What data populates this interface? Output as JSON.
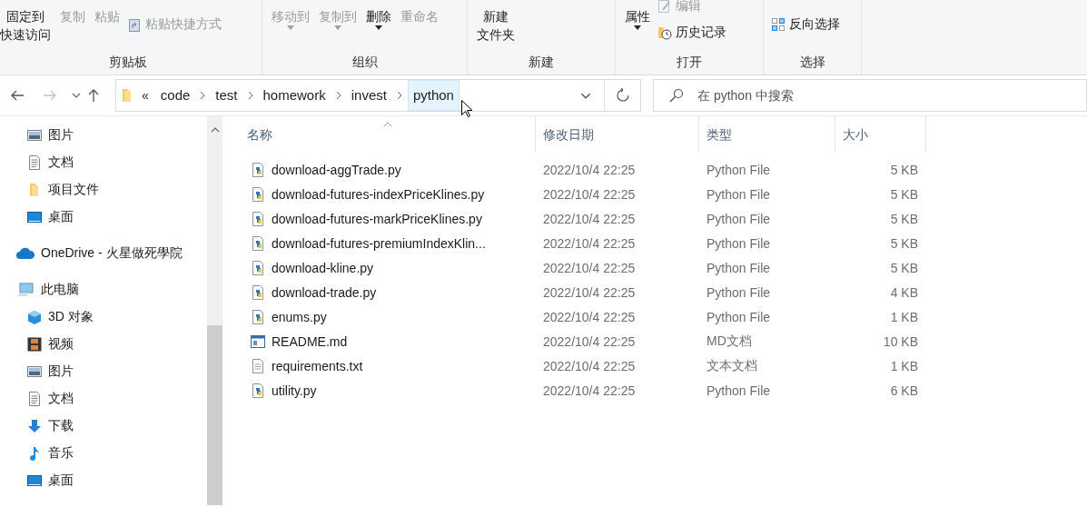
{
  "ribbon": {
    "groups": [
      {
        "label": "剪贴板",
        "large": [
          {
            "lines": [
              "固定到",
              "快速访问"
            ],
            "disabled": false,
            "dropdown": false
          },
          {
            "lines": [
              "复制"
            ],
            "disabled": true,
            "dropdown": false
          },
          {
            "lines": [
              "粘贴"
            ],
            "disabled": true,
            "dropdown": false
          }
        ],
        "small": [
          {
            "label": "粘贴快捷方式",
            "kind": "shortcut",
            "disabled": true,
            "dropdown": false
          }
        ]
      },
      {
        "label": "组织",
        "large": [
          {
            "lines": [
              "移动到"
            ],
            "disabled": true,
            "dropdown": true
          },
          {
            "lines": [
              "复制到"
            ],
            "disabled": true,
            "dropdown": true
          },
          {
            "lines": [
              "删除"
            ],
            "disabled": false,
            "dropdown": true
          },
          {
            "lines": [
              "重命名"
            ],
            "disabled": true,
            "dropdown": false
          }
        ]
      },
      {
        "label": "新建",
        "large": [
          {
            "lines": [
              "新建",
              "文件夹"
            ],
            "disabled": false,
            "dropdown": false
          }
        ]
      },
      {
        "label": "打开",
        "large": [
          {
            "lines": [
              "属性"
            ],
            "disabled": false,
            "dropdown": true
          }
        ],
        "small": [
          {
            "label": "编辑",
            "kind": "edit",
            "disabled": true,
            "dropdown": false
          },
          {
            "label": "历史记录",
            "kind": "history",
            "disabled": false,
            "dropdown": false
          }
        ]
      },
      {
        "label": "选择",
        "small": [
          {
            "label": "反向选择",
            "kind": "invert",
            "disabled": false,
            "dropdown": false
          }
        ]
      }
    ]
  },
  "address": {
    "overflow": "«",
    "segments": [
      {
        "label": "code",
        "highlighted": false
      },
      {
        "label": "test",
        "highlighted": false
      },
      {
        "label": "homework",
        "highlighted": false
      },
      {
        "label": "invest",
        "highlighted": false
      },
      {
        "label": "python",
        "highlighted": true
      }
    ]
  },
  "search": {
    "placeholder": "在 python 中搜索"
  },
  "sidebar": {
    "sections": [
      {
        "children": [
          {
            "label": "图片",
            "kind": "pictures"
          },
          {
            "label": "文档",
            "kind": "document"
          },
          {
            "label": "项目文件",
            "kind": "folder"
          },
          {
            "label": "桌面",
            "kind": "desktop"
          }
        ]
      },
      {
        "label": "OneDrive - 火星做死學院",
        "kind": "cloud"
      },
      {
        "label": "此电脑",
        "kind": "pc",
        "children": [
          {
            "label": "3D 对象",
            "kind": "cube"
          },
          {
            "label": "视频",
            "kind": "video"
          },
          {
            "label": "图片",
            "kind": "pictures"
          },
          {
            "label": "文档",
            "kind": "document"
          },
          {
            "label": "下载",
            "kind": "download"
          },
          {
            "label": "音乐",
            "kind": "music"
          },
          {
            "label": "桌面",
            "kind": "desktop"
          }
        ]
      }
    ]
  },
  "table": {
    "columns": [
      "名称",
      "修改日期",
      "类型",
      "大小"
    ],
    "rows": [
      {
        "name": "download-aggTrade.py",
        "kind": "python",
        "date": "2022/10/4 22:25",
        "type": "Python File",
        "size": "5 KB"
      },
      {
        "name": "download-futures-indexPriceKlines.py",
        "kind": "python",
        "date": "2022/10/4 22:25",
        "type": "Python File",
        "size": "5 KB"
      },
      {
        "name": "download-futures-markPriceKlines.py",
        "kind": "python",
        "date": "2022/10/4 22:25",
        "type": "Python File",
        "size": "5 KB"
      },
      {
        "name": "download-futures-premiumIndexKlin...",
        "kind": "python",
        "date": "2022/10/4 22:25",
        "type": "Python File",
        "size": "5 KB"
      },
      {
        "name": "download-kline.py",
        "kind": "python",
        "date": "2022/10/4 22:25",
        "type": "Python File",
        "size": "5 KB"
      },
      {
        "name": "download-trade.py",
        "kind": "python",
        "date": "2022/10/4 22:25",
        "type": "Python File",
        "size": "4 KB"
      },
      {
        "name": "enums.py",
        "kind": "python",
        "date": "2022/10/4 22:25",
        "type": "Python File",
        "size": "1 KB"
      },
      {
        "name": "README.md",
        "kind": "markdown",
        "date": "2022/10/4 22:25",
        "type": "MD文档",
        "size": "10 KB"
      },
      {
        "name": "requirements.txt",
        "kind": "text",
        "date": "2022/10/4 22:25",
        "type": "文本文档",
        "size": "1 KB"
      },
      {
        "name": "utility.py",
        "kind": "python",
        "date": "2022/10/4 22:25",
        "type": "Python File",
        "size": "6 KB"
      }
    ]
  }
}
